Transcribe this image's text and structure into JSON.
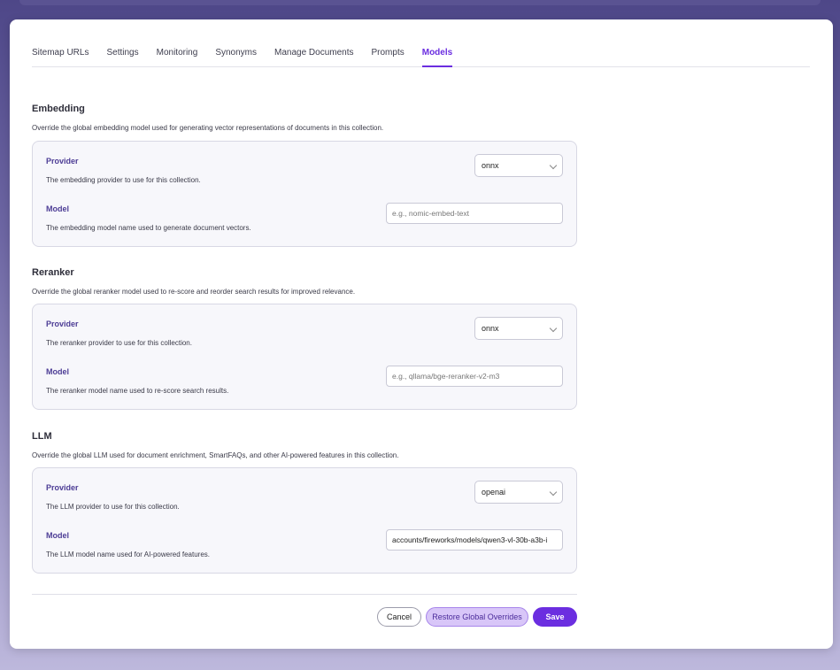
{
  "tabs": [
    {
      "label": "Sitemap URLs"
    },
    {
      "label": "Settings"
    },
    {
      "label": "Monitoring"
    },
    {
      "label": "Synonyms"
    },
    {
      "label": "Manage Documents"
    },
    {
      "label": "Prompts"
    },
    {
      "label": "Models"
    }
  ],
  "active_tab": "Models",
  "accent_color": "#6b2ee0",
  "embedding": {
    "title": "Embedding",
    "description": "Override the global embedding model used for generating vector representations of documents in this collection.",
    "provider_label": "Provider",
    "provider_desc": "The embedding provider to use for this collection.",
    "provider_value": "onnx",
    "model_label": "Model",
    "model_desc": "The embedding model name used to generate document vectors.",
    "model_value": "",
    "model_placeholder": "e.g., nomic-embed-text"
  },
  "reranker": {
    "title": "Reranker",
    "description": "Override the global reranker model used to re-score and reorder search results for improved relevance.",
    "provider_label": "Provider",
    "provider_desc": "The reranker provider to use for this collection.",
    "provider_value": "onnx",
    "model_label": "Model",
    "model_desc": "The reranker model name used to re-score search results.",
    "model_value": "",
    "model_placeholder": "e.g., qllama/bge-reranker-v2-m3"
  },
  "llm": {
    "title": "LLM",
    "description": "Override the global LLM used for document enrichment, SmartFAQs, and other AI-powered features in this collection.",
    "provider_label": "Provider",
    "provider_desc": "The LLM provider to use for this collection.",
    "provider_value": "openai",
    "model_label": "Model",
    "model_desc": "The LLM model name used for AI-powered features.",
    "model_value": "accounts/fireworks/models/qwen3-vl-30b-a3b-i",
    "model_placeholder": ""
  },
  "actions": {
    "cancel": "Cancel",
    "restore": "Restore Global Overrides",
    "save": "Save"
  }
}
